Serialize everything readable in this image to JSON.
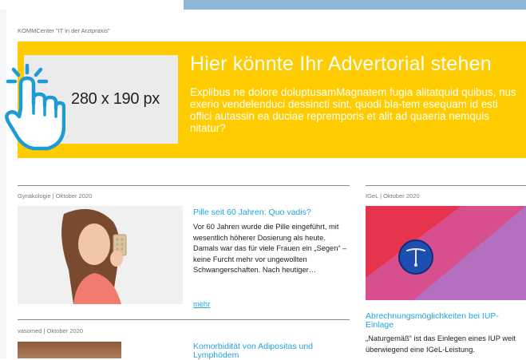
{
  "sponsor": {
    "label": "KOMMCenter \"IT in der Arztpraxis\""
  },
  "advertorial": {
    "placeholder_size": "280 x 190 px",
    "title": "Hier könnte Ihr Advertorial stehen",
    "body": "Explibus ne dolore doluptusamMagnatem fugia alitatquid quibus, nus exerio vendelenduci dessincti sint, quodi bla-tem esequam id esti offici autassin ea duciae repremporis et alit ad quaeria nemquis nitatur?",
    "bg_color": "#ffcc00"
  },
  "articles": [
    {
      "category": "Gynäkologie | Oktober 2020",
      "title": "Pille seit 60 Jahren: Quo vadis?",
      "text": "Vor 60 Jahren wurde die Pille eingeführt, mit wesentlich höherer Dosierung als heute. Damals war das für viele Frauen ein „Segen“ – keine Furcht mehr vor ungewollten Schwangerschaften. Nach heutiger…",
      "more": "mehr"
    },
    {
      "category": "vasomed | Oktober 2020",
      "title": "Komorbidität von Adipositas und Lymphödem"
    },
    {
      "category": "IGeL | Oktober 2020",
      "title": "Abrechnungsmöglichkeiten bei IUP-Einlage",
      "text": "„Naturgemäß“ ist das Einlegen eines IUP weit überwiegend eine IGeL-Leistung."
    }
  ],
  "icons": {
    "hand": "hand-pointer-click-icon"
  },
  "colors": {
    "accent": "#21a3dd",
    "topbar": "#8fb6d6"
  }
}
